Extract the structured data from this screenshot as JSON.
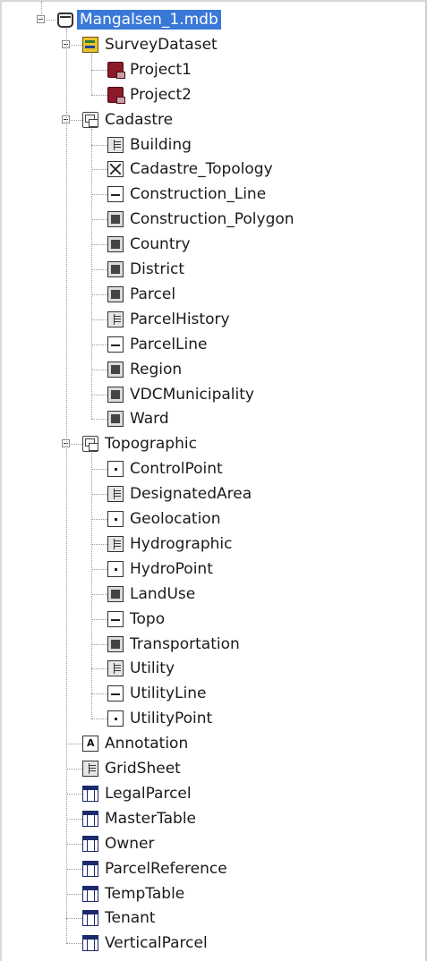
{
  "tree": {
    "root": {
      "label": "Mangalsen_1.mdb",
      "icon": "database-icon",
      "selected": true
    },
    "survey_dataset": {
      "label": "SurveyDataset",
      "icon": "survey-dataset-icon",
      "children": [
        {
          "label": "Project1",
          "icon": "survey-project-icon"
        },
        {
          "label": "Project2",
          "icon": "survey-project-icon"
        }
      ]
    },
    "cadastre": {
      "label": "Cadastre",
      "icon": "feature-dataset-icon",
      "children": [
        {
          "label": "Building",
          "icon": "feature-class-icon"
        },
        {
          "label": "Cadastre_Topology",
          "icon": "topology-icon"
        },
        {
          "label": "Construction_Line",
          "icon": "line-feature-class-icon"
        },
        {
          "label": "Construction_Polygon",
          "icon": "polygon-feature-class-icon"
        },
        {
          "label": "Country",
          "icon": "polygon-feature-class-icon"
        },
        {
          "label": "District",
          "icon": "polygon-feature-class-icon"
        },
        {
          "label": "Parcel",
          "icon": "polygon-feature-class-icon"
        },
        {
          "label": "ParcelHistory",
          "icon": "feature-class-icon"
        },
        {
          "label": "ParcelLine",
          "icon": "line-feature-class-icon"
        },
        {
          "label": "Region",
          "icon": "polygon-feature-class-icon"
        },
        {
          "label": "VDCMunicipality",
          "icon": "polygon-feature-class-icon"
        },
        {
          "label": "Ward",
          "icon": "polygon-feature-class-icon"
        }
      ]
    },
    "topographic": {
      "label": "Topographic",
      "icon": "feature-dataset-icon",
      "children": [
        {
          "label": "ControlPoint",
          "icon": "point-feature-class-icon"
        },
        {
          "label": "DesignatedArea",
          "icon": "feature-class-icon"
        },
        {
          "label": "Geolocation",
          "icon": "point-feature-class-icon"
        },
        {
          "label": "Hydrographic",
          "icon": "feature-class-icon"
        },
        {
          "label": "HydroPoint",
          "icon": "point-feature-class-icon"
        },
        {
          "label": "LandUse",
          "icon": "polygon-feature-class-icon"
        },
        {
          "label": "Topo",
          "icon": "line-feature-class-icon"
        },
        {
          "label": "Transportation",
          "icon": "polygon-feature-class-icon"
        },
        {
          "label": "Utility",
          "icon": "feature-class-icon"
        },
        {
          "label": "UtilityLine",
          "icon": "line-feature-class-icon"
        },
        {
          "label": "UtilityPoint",
          "icon": "point-feature-class-icon"
        }
      ]
    },
    "root_items": [
      {
        "label": "Annotation",
        "icon": "annotation-icon"
      },
      {
        "label": "GridSheet",
        "icon": "feature-class-icon"
      },
      {
        "label": "LegalParcel",
        "icon": "table-icon"
      },
      {
        "label": "MasterTable",
        "icon": "table-icon"
      },
      {
        "label": "Owner",
        "icon": "table-icon"
      },
      {
        "label": "ParcelReference",
        "icon": "table-icon"
      },
      {
        "label": "TempTable",
        "icon": "table-icon"
      },
      {
        "label": "Tenant",
        "icon": "table-icon"
      },
      {
        "label": "VerticalParcel",
        "icon": "table-icon"
      }
    ]
  }
}
